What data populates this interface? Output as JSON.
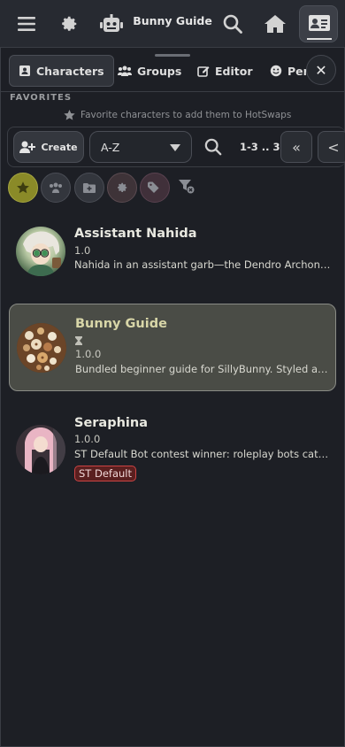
{
  "topbar": {
    "title": "Bunny Guide",
    "icons": [
      "hamburger-icon",
      "gear-icon",
      "robot-icon",
      "search-icon",
      "home-icon",
      "id-card-icon"
    ]
  },
  "tabs": [
    {
      "label": "Characters",
      "icon": "id-card-icon"
    },
    {
      "label": "Groups",
      "icon": "users-icon"
    },
    {
      "label": "Editor",
      "icon": "edit-icon"
    },
    {
      "label": "Pers",
      "icon": "smile-icon"
    }
  ],
  "close_label": "✕",
  "favorites": {
    "heading": "FAVORITES",
    "hint": "Favorite characters to add them to HotSwaps"
  },
  "controls": {
    "create_label": "Create",
    "sort_value": "A-Z",
    "pager_text": "1-3 .. 3",
    "first_page_glyph": "«",
    "prev_page_glyph": "<"
  },
  "filter_icons": [
    "star-icon",
    "group-icon",
    "folder-plus-icon",
    "gear-icon",
    "tags-icon",
    "filter-clear-icon"
  ],
  "colors": {
    "fav_filter": "#8a8a28",
    "tag_border": "#cc4444",
    "selected_card": "#4a4c46"
  },
  "characters": [
    {
      "name": "Assistant Nahida",
      "version": "1.0",
      "description": "Nahida in an assistant garb—the Dendro Archon of ...",
      "tag": ""
    },
    {
      "name": "Bunny Guide",
      "version": "1.0.0",
      "description": "Bundled beginner guide for SillyBunny. Styled as a ...",
      "tag": "",
      "selected": true
    },
    {
      "name": "Seraphina",
      "version": "1.0.0",
      "description": "ST Default Bot contest winner: roleplay bots categ...",
      "tag": "ST Default"
    }
  ]
}
